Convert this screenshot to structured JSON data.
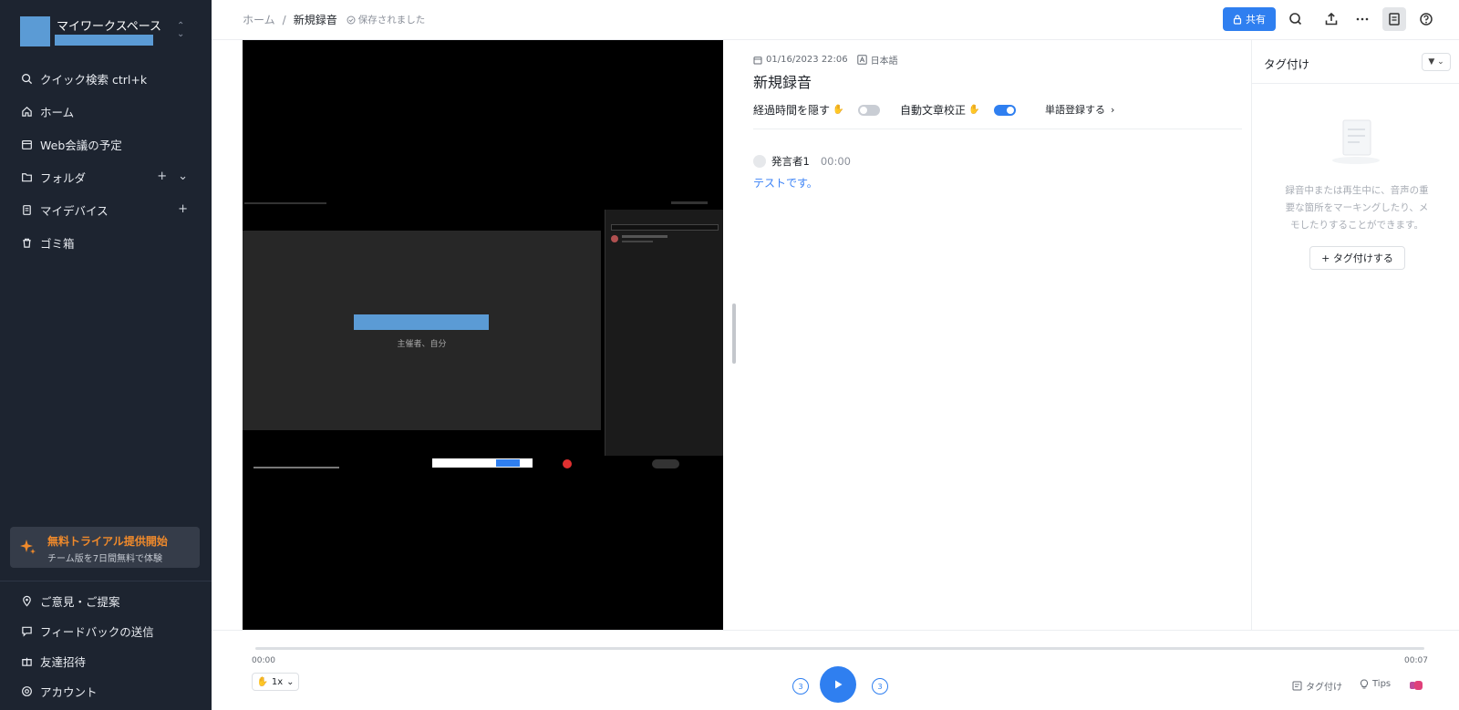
{
  "sidebar": {
    "workspace_name": "マイワークスペース",
    "nav": [
      {
        "label": "クイック検索 ctrl+k",
        "icon": "search-icon"
      },
      {
        "label": "ホーム",
        "icon": "home-icon"
      },
      {
        "label": "Web会議の予定",
        "icon": "calendar-icon"
      },
      {
        "label": "フォルダ",
        "icon": "folder-icon"
      },
      {
        "label": "マイデバイス",
        "icon": "device-icon"
      },
      {
        "label": "ゴミ箱",
        "icon": "trash-icon"
      }
    ],
    "trial_title": "無料トライアル提供開始",
    "trial_sub": "チーム版を7日間無料で体験",
    "footer_nav": [
      {
        "label": "ご意見・ご提案",
        "icon": "pin-icon"
      },
      {
        "label": "フィードバックの送信",
        "icon": "message-icon"
      },
      {
        "label": "友達招待",
        "icon": "gift-icon"
      },
      {
        "label": "アカウント",
        "icon": "account-icon"
      }
    ]
  },
  "topbar": {
    "breadcrumb_home": "ホーム",
    "breadcrumb_sep": "/",
    "breadcrumb_current": "新規録音",
    "saved_status": "保存されました",
    "share_label": "共有"
  },
  "video": {
    "host_label": "主催者、自分"
  },
  "transcript": {
    "date": "01/16/2023 22:06",
    "language": "日本語",
    "title": "新規録音",
    "hide_elapsed_label": "経過時間を隠す",
    "auto_correct_label": "自動文章校正",
    "word_register_label": "単語登録する",
    "speaker_name": "発言者1",
    "speaker_time": "00:00",
    "line_text": "テストです。"
  },
  "tagpanel": {
    "title": "タグ付け",
    "empty_line1": "録音中または再生中に、音声の重",
    "empty_line2": "要な箇所をマーキングしたり、メ",
    "empty_line3": "モしたりすることができます。",
    "add_label": "+ タグ付けする"
  },
  "player": {
    "time_start": "00:00",
    "time_end": "00:07",
    "speed": "1x",
    "skip_back": "3",
    "skip_fwd": "3",
    "tag_label": "タグ付け",
    "tips_label": "Tips"
  },
  "colors": {
    "sidebar_bg": "#1d2430",
    "accent": "#2f7ff0",
    "trial_accent": "#f08a2b",
    "redacted": "#5b9bd5"
  }
}
